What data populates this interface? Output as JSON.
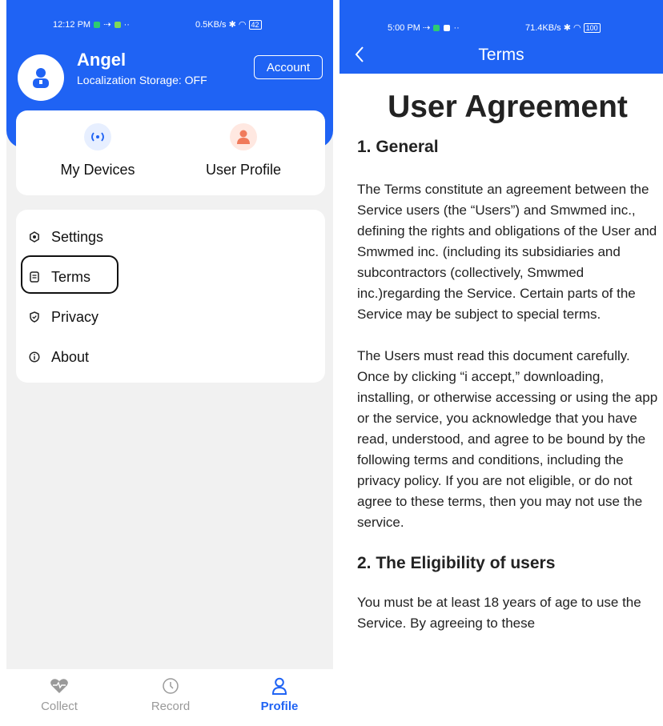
{
  "left": {
    "status_bar": {
      "time": "12:12 PM",
      "dots": "··",
      "speed": "0.5KB/s",
      "battery": "42"
    },
    "user": {
      "name": "Angel",
      "subtitle": "Localization Storage: OFF"
    },
    "account_button": "Account",
    "shortcuts": [
      {
        "label": "My Devices",
        "icon": "radio-waves-icon",
        "color": "#1f63f4",
        "bg": "#e7efff"
      },
      {
        "label": "User Profile",
        "icon": "person-icon",
        "color": "#f07a5b",
        "bg": "#ffe8e1"
      }
    ],
    "menu": [
      {
        "label": "Settings",
        "icon": "gear-icon"
      },
      {
        "label": "Terms",
        "icon": "document-icon"
      },
      {
        "label": "Privacy",
        "icon": "shield-icon"
      },
      {
        "label": "About",
        "icon": "info-icon"
      }
    ],
    "tabs": [
      {
        "label": "Collect",
        "icon": "heart-pulse-icon"
      },
      {
        "label": "Record",
        "icon": "clock-icon"
      },
      {
        "label": "Profile",
        "icon": "user-outline-icon"
      }
    ],
    "active_tab": "Profile",
    "colors": {
      "primary": "#1f63f4",
      "background": "#f1f1f1"
    }
  },
  "right": {
    "status_bar": {
      "time": "5:00 PM",
      "dots": "··",
      "speed": "71.4KB/s",
      "battery": "100"
    },
    "nav_title": "Terms",
    "doc": {
      "title": "User Agreement",
      "section1_heading": "1. General",
      "section1_p1": "The Terms constitute an agreement between the Service users (the “Users”) and Smwmed inc., defining the rights and obligations of the User and Smwmed inc. (including its subsidiaries and subcontractors (collectively, Smwmed inc.)regarding the Service. Certain parts of the Service may be subject to special terms.",
      "section1_p2": "The Users must read this document carefully. Once by clicking “i accept,” downloading, installing, or otherwise accessing or using the app or the service, you acknowledge that you have read, understood, and agree to be bound by the following terms and conditions, including the privacy policy. If you are not eligible, or do not agree to these terms, then you may not use the service.",
      "section2_heading": "2. The Eligibility of users",
      "section2_p1": "You must be at least 18 years of age to use the Service. By agreeing to these"
    }
  }
}
